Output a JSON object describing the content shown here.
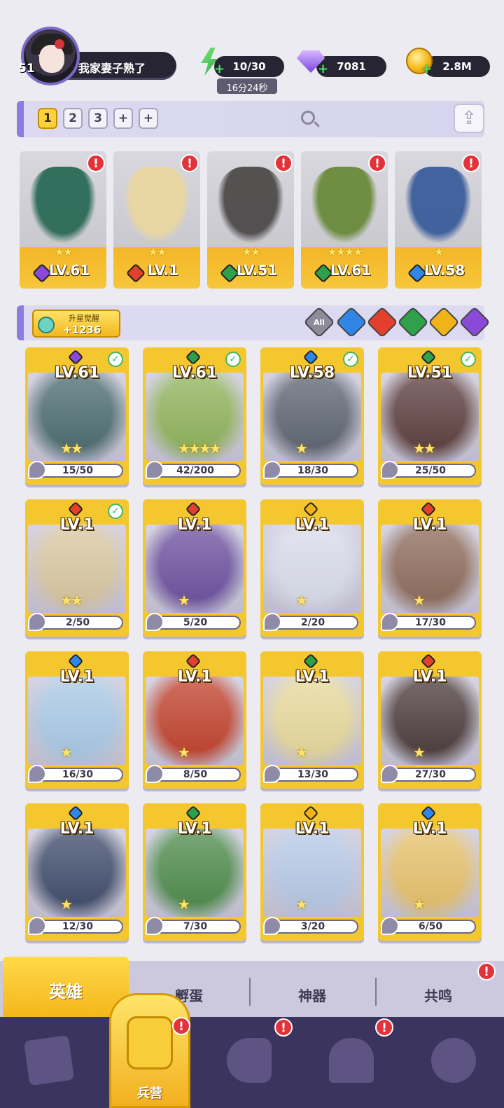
{
  "player": {
    "level": "51",
    "name": "我家妻子熟了"
  },
  "resources": {
    "energy": "10/30",
    "energy_timer": "16分24秒",
    "gems": "7081",
    "gold": "2.8M"
  },
  "team_tabs": [
    "1",
    "2",
    "3",
    "+",
    "+"
  ],
  "team": [
    {
      "level": "LV.61",
      "element": "dark",
      "stars": "★★",
      "alert": "!",
      "art": "#2a6a55"
    },
    {
      "level": "LV.1",
      "element": "fire",
      "stars": "★★",
      "alert": "!",
      "art": "#e9d7a0"
    },
    {
      "level": "LV.51",
      "element": "nature",
      "stars": "★★",
      "alert": "!",
      "art": "#4d4a4a"
    },
    {
      "level": "LV.61",
      "element": "nature",
      "stars": "★★★★",
      "alert": "!",
      "art": "#6a8a3a"
    },
    {
      "level": "LV.58",
      "element": "water",
      "stars": "★",
      "alert": "!",
      "art": "#3a5d9a"
    }
  ],
  "awaken": {
    "label": "升星觉醒",
    "count": "+1236"
  },
  "filters": {
    "all_label": "All",
    "elements": [
      "water",
      "fire",
      "nature",
      "light",
      "dark"
    ]
  },
  "element_colors": {
    "water": "#2f86e6",
    "fire": "#e2402c",
    "nature": "#2fa14a",
    "light": "#f0b41a",
    "dark": "#8a49d8"
  },
  "heroes": [
    {
      "level": "LV.61",
      "element": "dark",
      "shards": "15/50",
      "checked": true,
      "stars": "★★",
      "art": "#4a6a6e"
    },
    {
      "level": "LV.61",
      "element": "nature",
      "shards": "42/200",
      "checked": true,
      "stars": "★★★★",
      "art": "#8fb25a"
    },
    {
      "level": "LV.58",
      "element": "water",
      "shards": "18/30",
      "checked": true,
      "stars": "★",
      "art": "#5c6470"
    },
    {
      "level": "LV.51",
      "element": "nature",
      "shards": "25/50",
      "checked": true,
      "stars": "★★",
      "art": "#5b3c3c"
    },
    {
      "level": "LV.1",
      "element": "fire",
      "shards": "2/50",
      "checked": true,
      "stars": "★★",
      "art": "#d8c6a0"
    },
    {
      "level": "LV.1",
      "element": "fire",
      "shards": "5/20",
      "checked": false,
      "stars": "★",
      "art": "#6b4f9e"
    },
    {
      "level": "LV.1",
      "element": "light",
      "shards": "2/20",
      "checked": false,
      "stars": "★",
      "art": "#d8dcea"
    },
    {
      "level": "LV.1",
      "element": "fire",
      "shards": "17/30",
      "checked": false,
      "stars": "★",
      "art": "#8c6a5a"
    },
    {
      "level": "LV.1",
      "element": "water",
      "shards": "16/30",
      "checked": false,
      "stars": "★",
      "art": "#a8c8e6"
    },
    {
      "level": "LV.1",
      "element": "fire",
      "shards": "8/50",
      "checked": false,
      "stars": "★",
      "art": "#c0402c"
    },
    {
      "level": "LV.1",
      "element": "nature",
      "shards": "13/30",
      "checked": false,
      "stars": "★",
      "art": "#e6d89a"
    },
    {
      "level": "LV.1",
      "element": "fire",
      "shards": "27/30",
      "checked": false,
      "stars": "★",
      "art": "#4a3a3a"
    },
    {
      "level": "LV.1",
      "element": "water",
      "shards": "12/30",
      "checked": false,
      "stars": "★",
      "art": "#3d4a6a"
    },
    {
      "level": "LV.1",
      "element": "nature",
      "shards": "7/30",
      "checked": false,
      "stars": "★",
      "art": "#4c8a4a"
    },
    {
      "level": "LV.1",
      "element": "light",
      "shards": "3/20",
      "checked": false,
      "stars": "★",
      "art": "#b6c8e6"
    },
    {
      "level": "LV.1",
      "element": "water",
      "shards": "6/50",
      "checked": false,
      "stars": "★",
      "art": "#e6c06a"
    }
  ],
  "tabs": {
    "heroes": "英雄",
    "eggs": "孵蛋",
    "artifacts": "神器",
    "resonance": "共鸣"
  },
  "nav": {
    "barracks": "兵营"
  },
  "alert_mark": "!",
  "check_mark": "✓",
  "share_glyph": "⇪"
}
